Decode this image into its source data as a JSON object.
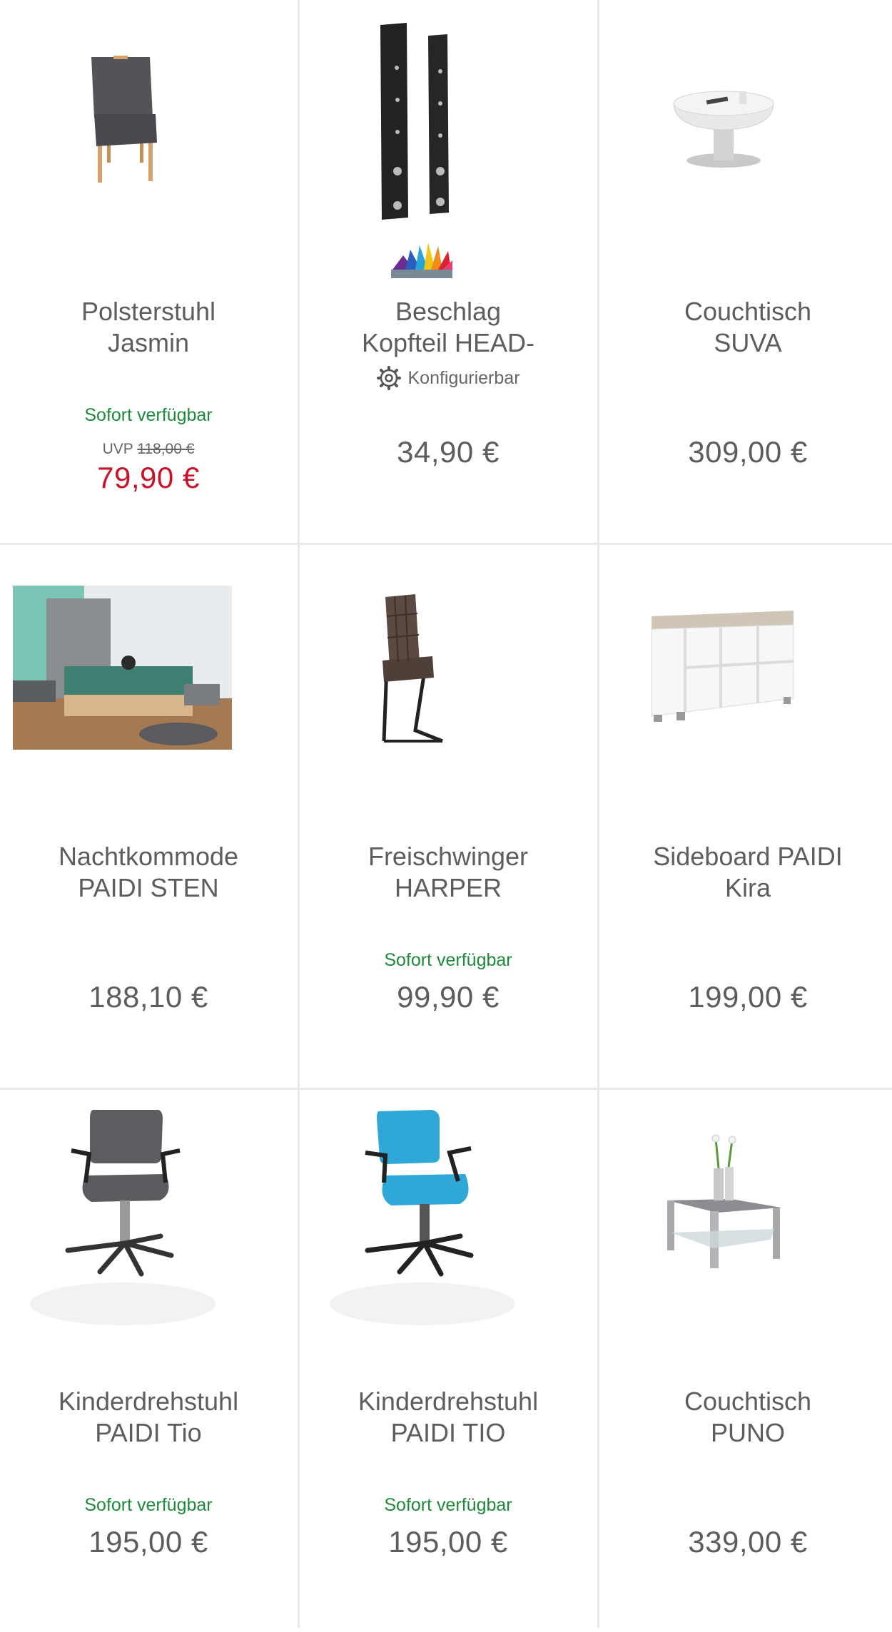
{
  "products": [
    {
      "name_line1": "Polsterstuhl",
      "name_line2": "Jasmin",
      "availability": "Sofort verfügbar",
      "uvp_label": "UVP",
      "uvp_price": "118,00 €",
      "price": "79,90 €",
      "image_icon": "upholstered-chair-icon"
    },
    {
      "name_line1": "Beschlag",
      "name_line2": "Kopfteil HEAD-",
      "configurable": "Konfigurierbar",
      "price": "34,90 €",
      "image_icon": "headboard-fitting-icon"
    },
    {
      "name_line1": "Couchtisch",
      "name_line2": "SUVA",
      "price": "309,00 €",
      "image_icon": "round-coffee-table-icon"
    },
    {
      "name_line1": "Nachtkommode",
      "name_line2": "PAIDI STEN",
      "price": "188,10 €",
      "image_icon": "bedroom-photo-icon"
    },
    {
      "name_line1": "Freischwinger",
      "name_line2": "HARPER",
      "availability": "Sofort verfügbar",
      "price": "99,90 €",
      "image_icon": "cantilever-chair-icon"
    },
    {
      "name_line1": "Sideboard PAIDI",
      "name_line2": "Kira",
      "price": "199,00 €",
      "image_icon": "sideboard-icon"
    },
    {
      "name_line1": "Kinderdrehstuhl",
      "name_line2": "PAIDI Tio",
      "availability": "Sofort verfügbar",
      "price": "195,00 €",
      "image_icon": "grey-office-chair-icon"
    },
    {
      "name_line1": "Kinderdrehstuhl",
      "name_line2": "PAIDI TIO",
      "availability": "Sofort verfügbar",
      "price": "195,00 €",
      "image_icon": "blue-office-chair-icon"
    },
    {
      "name_line1": "Couchtisch",
      "name_line2": "PUNO",
      "price": "339,00 €",
      "image_icon": "square-coffee-table-icon"
    }
  ],
  "colors": {
    "availability_green": "#1f8a3c",
    "sale_red": "#c8142b",
    "text_grey": "#5d5d5d",
    "divider": "#e8e8e8"
  }
}
